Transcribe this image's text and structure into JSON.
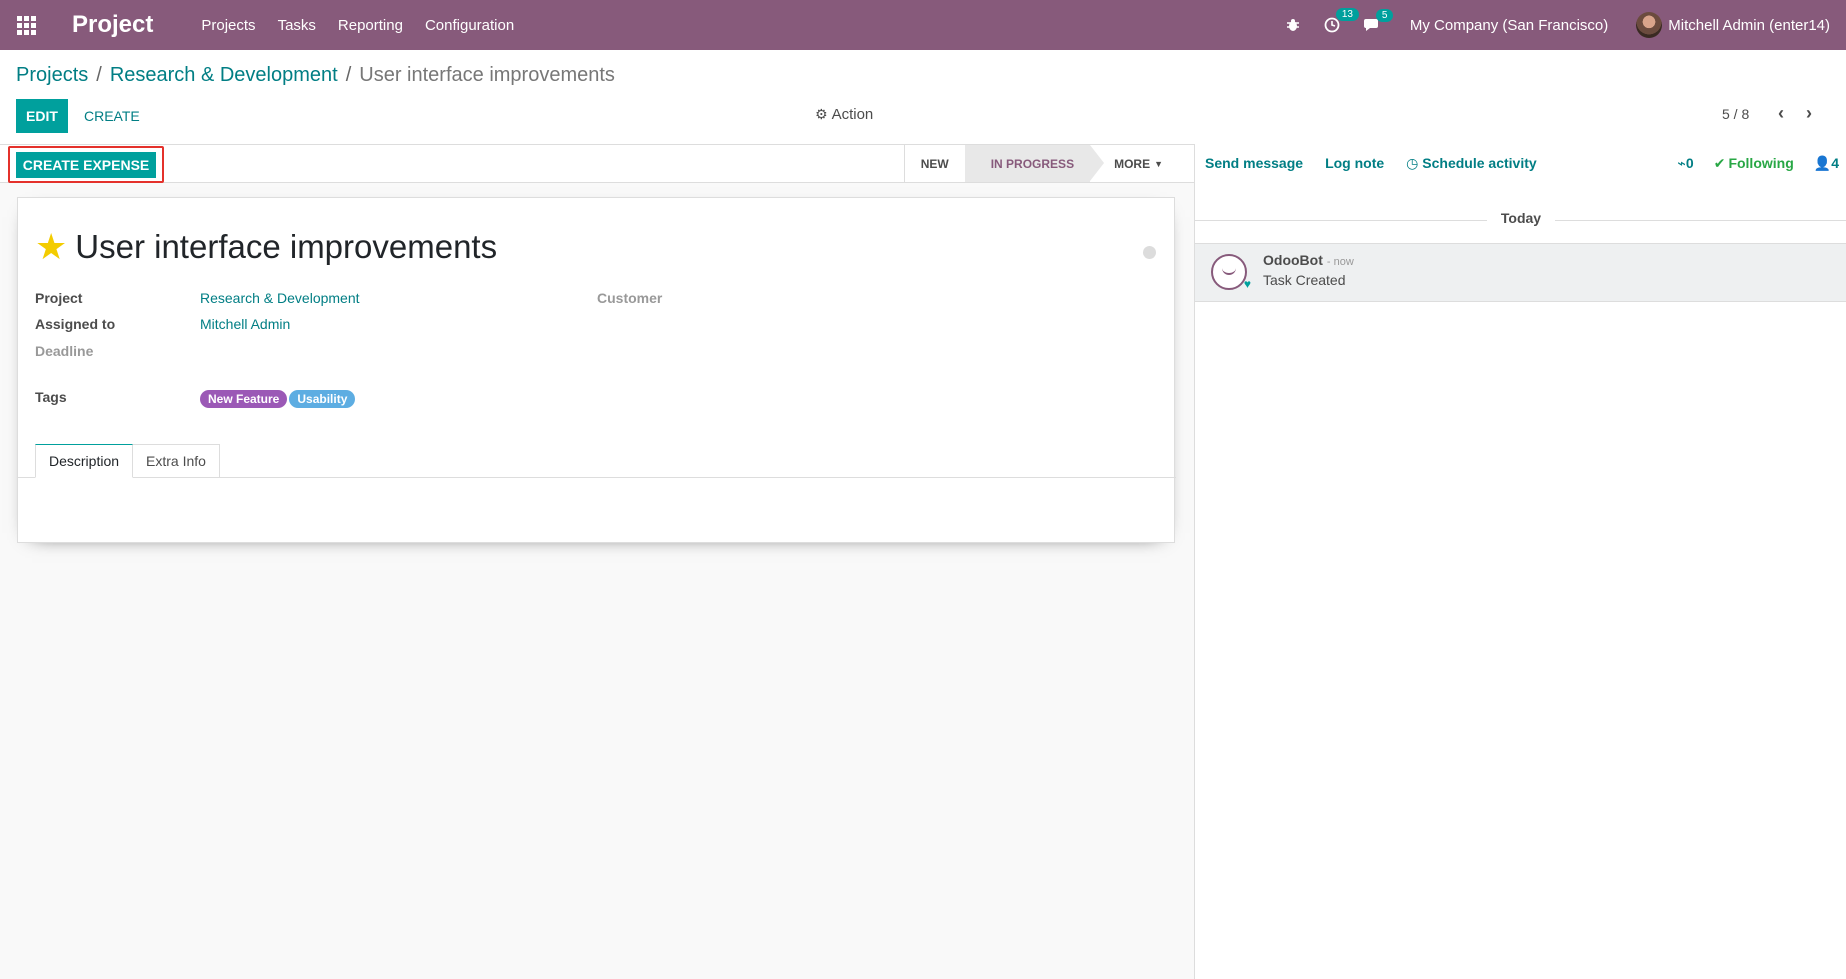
{
  "navbar": {
    "app_name": "Project",
    "menu": [
      "Projects",
      "Tasks",
      "Reporting",
      "Configuration"
    ],
    "activity_count": "13",
    "message_count": "5",
    "company": "My Company (San Francisco)",
    "user": "Mitchell Admin (enter14)"
  },
  "breadcrumb": {
    "items": [
      "Projects",
      "Research & Development",
      "User interface improvements"
    ],
    "separator": "/"
  },
  "control": {
    "edit_label": "EDIT",
    "create_label": "CREATE",
    "action_label": "Action",
    "pager": "5 / 8"
  },
  "statusbar": {
    "create_expense_label": "CREATE EXPENSE",
    "stages": [
      "NEW",
      "IN PROGRESS",
      "MORE"
    ],
    "current_stage": "IN PROGRESS"
  },
  "form": {
    "title": "User interface improvements",
    "starred": true,
    "fields": {
      "project_label": "Project",
      "project_value": "Research & Development",
      "assigned_label": "Assigned to",
      "assigned_value": "Mitchell Admin",
      "deadline_label": "Deadline",
      "tags_label": "Tags",
      "customer_label": "Customer"
    },
    "tags": [
      {
        "label": "New Feature",
        "color": "#9b59b6"
      },
      {
        "label": "Usability",
        "color": "#5dade2"
      }
    ],
    "tabs": [
      "Description",
      "Extra Info"
    ]
  },
  "chatter": {
    "send_message": "Send message",
    "log_note": "Log note",
    "schedule_activity": "Schedule activity",
    "attachments": "0",
    "following": "Following",
    "followers": "4",
    "date_separator": "Today",
    "messages": [
      {
        "author": "OdooBot",
        "time": "- now",
        "body": "Task Created"
      }
    ]
  },
  "colors": {
    "brand": "#875a7b",
    "accent": "#00a09d",
    "link": "#017e84",
    "highlight": "#e4312b"
  }
}
